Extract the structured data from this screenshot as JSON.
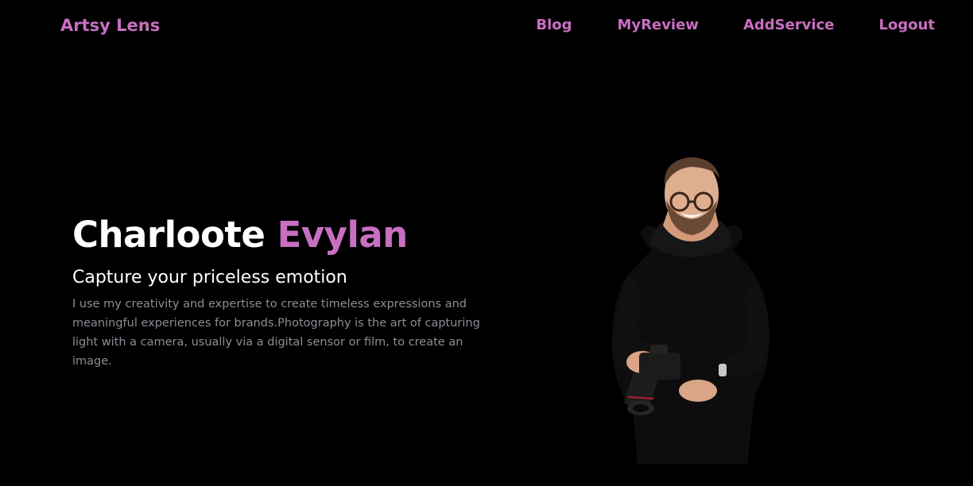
{
  "nav": {
    "brand": "Artsy Lens",
    "links": [
      {
        "label": "Blog"
      },
      {
        "label": "MyReview"
      },
      {
        "label": "AddService"
      },
      {
        "label": "Logout"
      }
    ]
  },
  "hero": {
    "first_name": "Charloote",
    "last_name": "Evylan",
    "subtitle": "Capture your priceless emotion",
    "description": "I use my creativity and expertise to create timeless expressions and meaningful experiences for brands.Photography is the art of capturing light with a camera, usually via a digital sensor or film, to create an image.",
    "photo_icon": "photographer-with-camera-icon"
  },
  "colors": {
    "background": "#000000",
    "accent": "#c86fc0",
    "text": "#ffffff",
    "muted": "#8c8e96"
  }
}
